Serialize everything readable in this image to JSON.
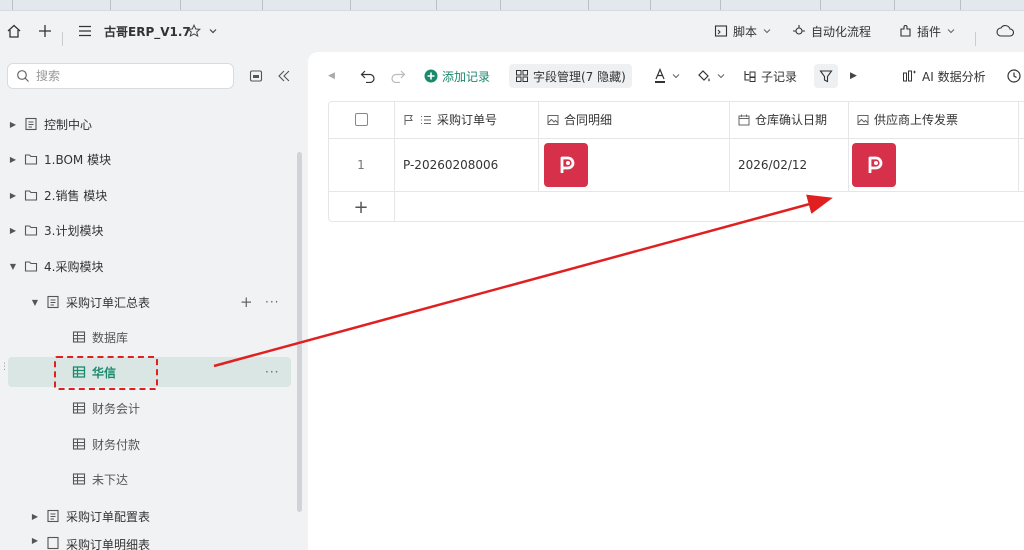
{
  "window": {
    "title": "古哥ERP_V1.7"
  },
  "header": {
    "script_label": "脚本",
    "automation_label": "自动化流程",
    "plugin_label": "插件"
  },
  "sidebar": {
    "search_placeholder": "搜索",
    "tree": [
      {
        "label": "控制中心"
      },
      {
        "label": "1.BOM 模块"
      },
      {
        "label": "2.销售 模块"
      },
      {
        "label": "3.计划模块"
      },
      {
        "label": "4.采购模块"
      },
      {
        "label": "采购订单汇总表"
      },
      {
        "label": "数据库"
      },
      {
        "label": "华信"
      },
      {
        "label": "财务会计"
      },
      {
        "label": "财务付款"
      },
      {
        "label": "未下达"
      },
      {
        "label": "采购订单配置表"
      },
      {
        "label": "采购订单明细表"
      }
    ]
  },
  "toolbar": {
    "add_record": "添加记录",
    "field_manage": "字段管理(7 隐藏)",
    "sub_record": "子记录",
    "ai_analysis": "AI 数据分析"
  },
  "table": {
    "columns": [
      "采购订单号",
      "合同明细",
      "仓库确认日期",
      "供应商上传发票"
    ],
    "rows": [
      {
        "index": "1",
        "order_no": "P-20260208006",
        "date": "2026/02/12"
      }
    ],
    "add_row": "+"
  },
  "colors": {
    "accent": "#1a8a6e",
    "pdf": "#d6304a",
    "annotation": "#e02020"
  }
}
